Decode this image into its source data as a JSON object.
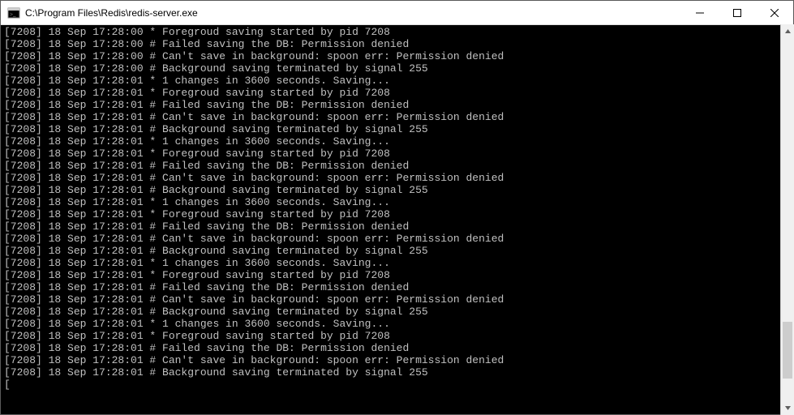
{
  "window": {
    "title": "C:\\Program Files\\Redis\\redis-server.exe"
  },
  "controls": {
    "minimize": "minimize",
    "maximize": "maximize",
    "close": "close"
  },
  "console": {
    "prefix_pid": "[7208]",
    "prefix_date": "18 Sep",
    "lines": [
      "[7208] 18 Sep 17:28:00 * Foregroud saving started by pid 7208",
      "[7208] 18 Sep 17:28:00 # Failed saving the DB: Permission denied",
      "[7208] 18 Sep 17:28:00 # Can't save in background: spoon err: Permission denied",
      "[7208] 18 Sep 17:28:00 # Background saving terminated by signal 255",
      "[7208] 18 Sep 17:28:01 * 1 changes in 3600 seconds. Saving...",
      "[7208] 18 Sep 17:28:01 * Foregroud saving started by pid 7208",
      "[7208] 18 Sep 17:28:01 # Failed saving the DB: Permission denied",
      "[7208] 18 Sep 17:28:01 # Can't save in background: spoon err: Permission denied",
      "[7208] 18 Sep 17:28:01 # Background saving terminated by signal 255",
      "[7208] 18 Sep 17:28:01 * 1 changes in 3600 seconds. Saving...",
      "[7208] 18 Sep 17:28:01 * Foregroud saving started by pid 7208",
      "[7208] 18 Sep 17:28:01 # Failed saving the DB: Permission denied",
      "[7208] 18 Sep 17:28:01 # Can't save in background: spoon err: Permission denied",
      "[7208] 18 Sep 17:28:01 # Background saving terminated by signal 255",
      "[7208] 18 Sep 17:28:01 * 1 changes in 3600 seconds. Saving...",
      "[7208] 18 Sep 17:28:01 * Foregroud saving started by pid 7208",
      "[7208] 18 Sep 17:28:01 # Failed saving the DB: Permission denied",
      "[7208] 18 Sep 17:28:01 # Can't save in background: spoon err: Permission denied",
      "[7208] 18 Sep 17:28:01 # Background saving terminated by signal 255",
      "[7208] 18 Sep 17:28:01 * 1 changes in 3600 seconds. Saving...",
      "[7208] 18 Sep 17:28:01 * Foregroud saving started by pid 7208",
      "[7208] 18 Sep 17:28:01 # Failed saving the DB: Permission denied",
      "[7208] 18 Sep 17:28:01 # Can't save in background: spoon err: Permission denied",
      "[7208] 18 Sep 17:28:01 # Background saving terminated by signal 255",
      "[7208] 18 Sep 17:28:01 * 1 changes in 3600 seconds. Saving...",
      "[7208] 18 Sep 17:28:01 * Foregroud saving started by pid 7208",
      "[7208] 18 Sep 17:28:01 # Failed saving the DB: Permission denied",
      "[7208] 18 Sep 17:28:01 # Can't save in background: spoon err: Permission denied",
      "[7208] 18 Sep 17:28:01 # Background saving terminated by signal 255"
    ],
    "cursor_line": "["
  }
}
